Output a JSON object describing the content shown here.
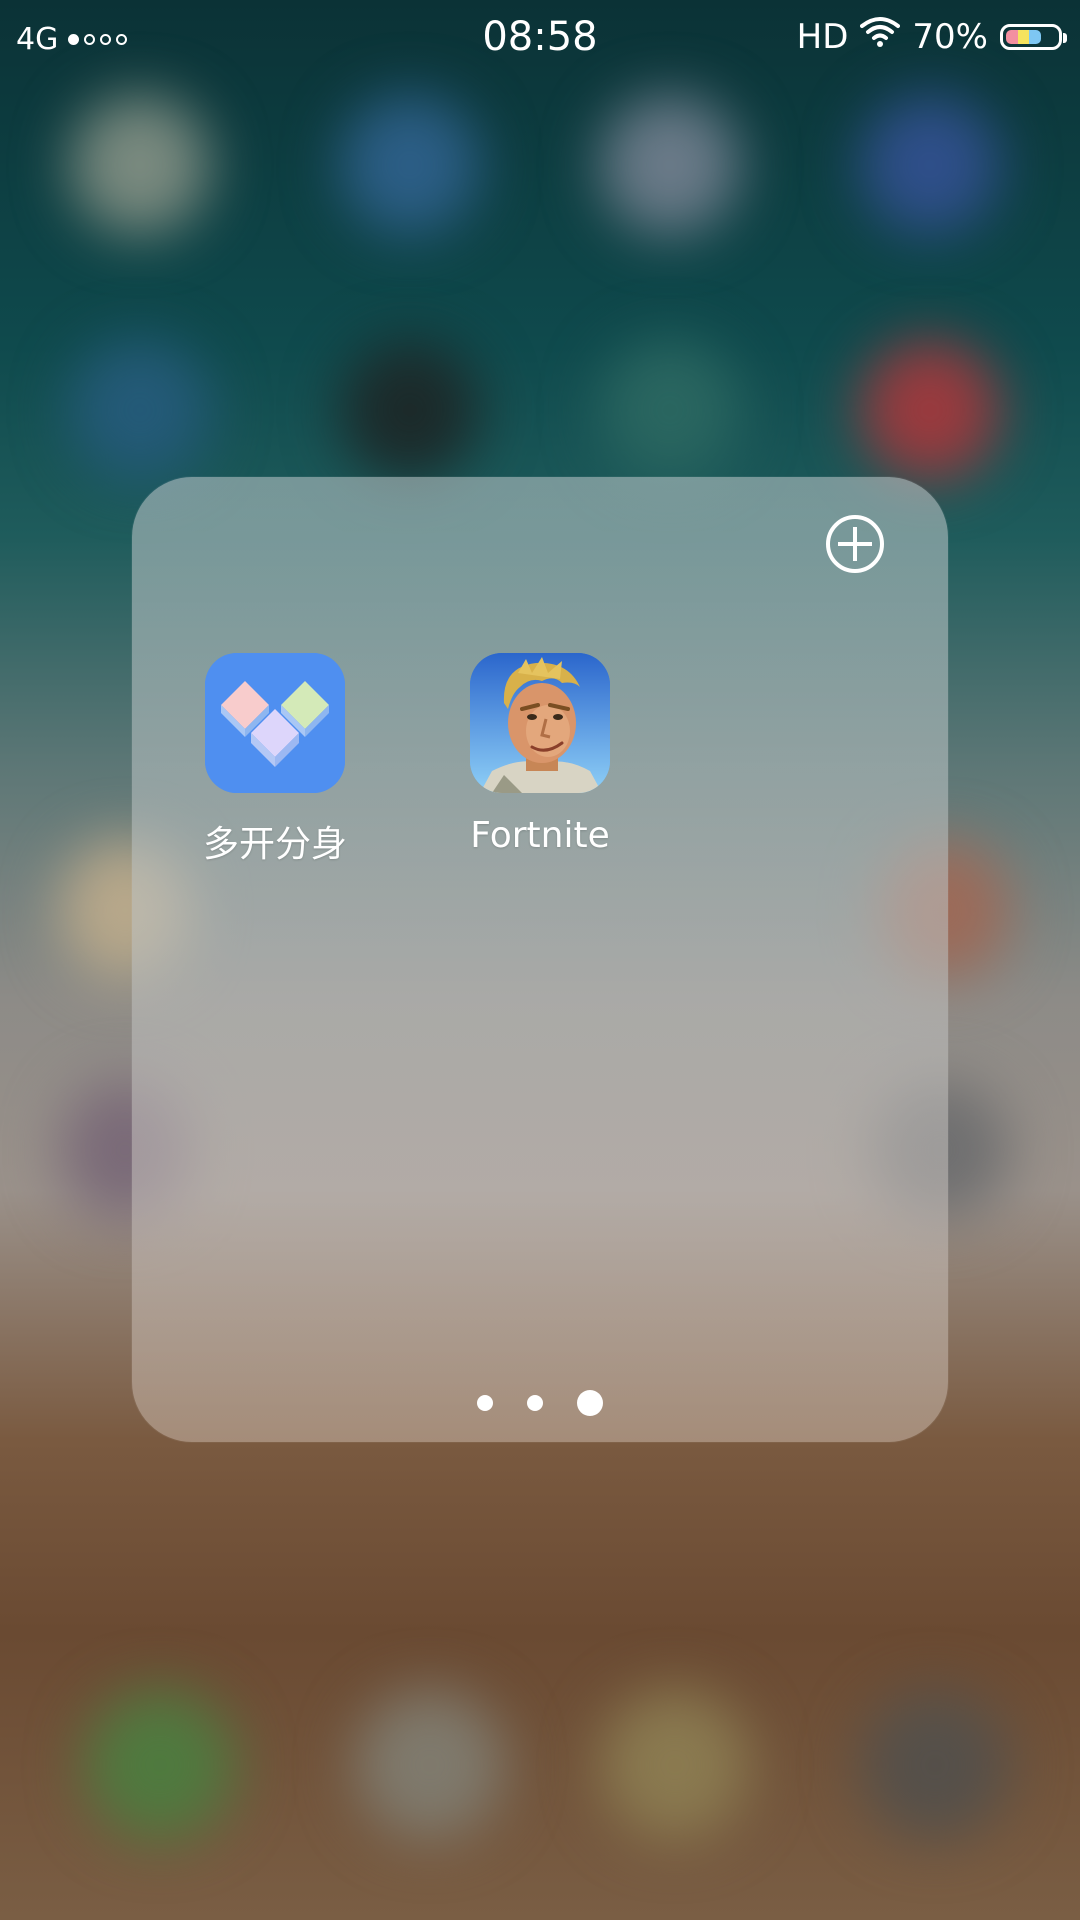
{
  "status_bar": {
    "network": "4G",
    "signal_strength": 1,
    "signal_max": 4,
    "time": "08:58",
    "hd": "HD",
    "wifi_icon": "wifi-icon",
    "battery_percent": "70%",
    "battery_level": 0.7
  },
  "folder": {
    "add_icon": "plus-circle-icon",
    "apps": [
      {
        "label": "多开分身",
        "icon": "multi-clone-app-icon",
        "color": "#4f8ff0"
      },
      {
        "label": "Fortnite",
        "icon": "fortnite-app-icon",
        "color": "#3b86e4"
      }
    ],
    "pages": 3,
    "current_page": 3
  },
  "colors": {
    "folder_bg": "#b8bebe",
    "text": "#ffffff"
  }
}
